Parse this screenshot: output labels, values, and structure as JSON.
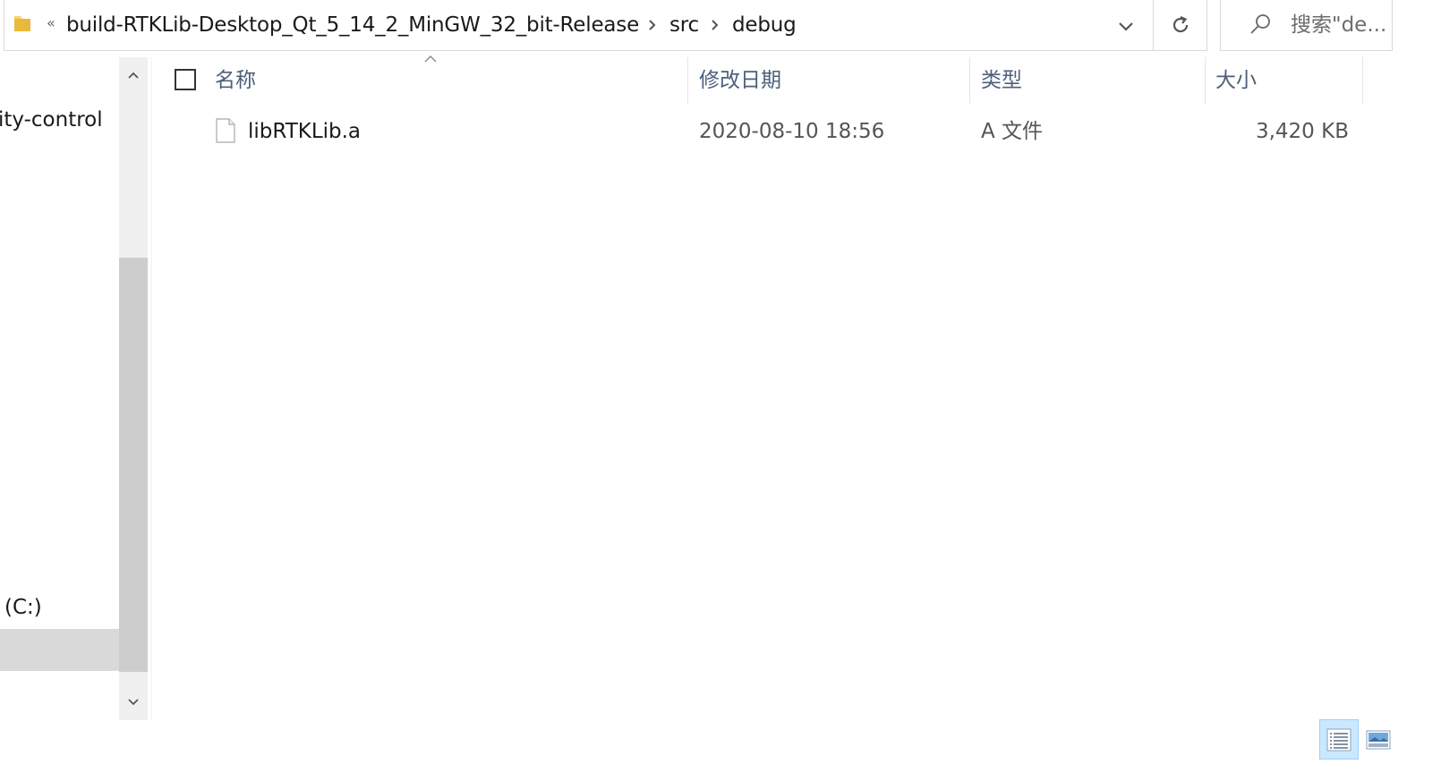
{
  "address_bar": {
    "overflow": "«",
    "breadcrumbs": [
      "build-RTKLib-Desktop_Qt_5_14_2_MinGW_32_bit-Release",
      "src",
      "debug"
    ]
  },
  "search": {
    "placeholder": "搜索\"de..."
  },
  "navigation_pane": {
    "items": [
      "ity-control",
      "(C:)"
    ]
  },
  "file_list": {
    "columns": [
      "名称",
      "修改日期",
      "类型",
      "大小"
    ],
    "sorted_column": "名称",
    "rows": [
      {
        "name": "libRTKLib.a",
        "modified": "2020-08-10 18:56",
        "type": "A 文件",
        "size": "3,420 KB"
      }
    ]
  },
  "colors": {
    "header_text": "#4c607a",
    "selection_bg": "#cce8ff",
    "nav_selected_bg": "#d9d9d9",
    "scrollbar_thumb": "#cdcdcd"
  }
}
